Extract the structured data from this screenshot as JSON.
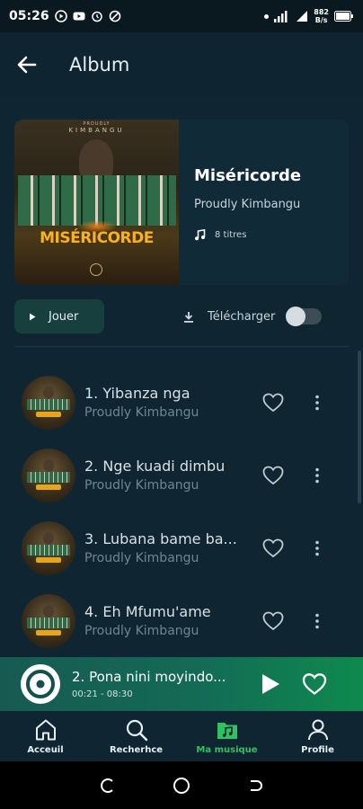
{
  "status_bar": {
    "time": "05:26",
    "network": "5G",
    "speed_top": "882",
    "speed_unit": "B/s"
  },
  "header": {
    "title": "Album",
    "back_icon": "arrow-left-icon"
  },
  "album": {
    "title": "Miséricorde",
    "artist": "Proudly Kimbangu",
    "track_count": "8 titres",
    "cover_text_top": "PROUDLY",
    "cover_text_name": "KIMBANGU",
    "cover_title": "MISÉRICORDE"
  },
  "actions": {
    "play_label": "Jouer",
    "download_label": "Télécharger",
    "download_enabled": false
  },
  "tracks": [
    {
      "title": "1. Yibanza nga",
      "artist": "Proudly Kimbangu"
    },
    {
      "title": "2. Nge kuadi dimbu",
      "artist": "Proudly Kimbangu"
    },
    {
      "title": "3. Lubana bame ba...",
      "artist": "Proudly Kimbangu"
    },
    {
      "title": "4. Eh Mfumu'ame",
      "artist": "Proudly Kimbangu"
    }
  ],
  "now_playing": {
    "title": "2. Pona nini moyindo...",
    "elapsed": "00:21",
    "duration": "08:30",
    "time_text": "00:21 - 08:30"
  },
  "nav": {
    "items": [
      {
        "label": "Acceuil",
        "icon": "home-icon",
        "active": false
      },
      {
        "label": "Recherhce",
        "icon": "search-icon",
        "active": false
      },
      {
        "label": "Ma musique",
        "icon": "music-folder-icon",
        "active": true
      },
      {
        "label": "Profile",
        "icon": "person-icon",
        "active": false
      }
    ]
  },
  "colors": {
    "accent": "#2fc25f",
    "background": "#0f2632",
    "play_button": "#173f3e",
    "mini_player_start": "#175a52",
    "mini_player_end": "#0e8a4e"
  }
}
